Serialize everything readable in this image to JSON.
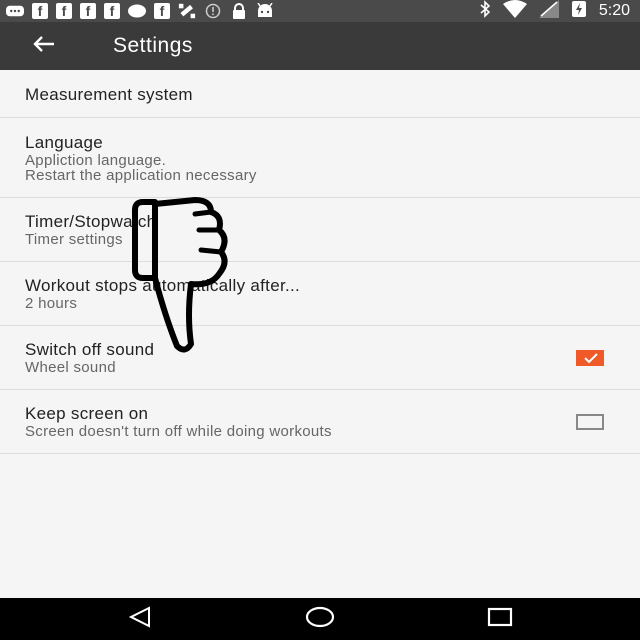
{
  "status_bar": {
    "time": "5:20",
    "fb_letter": "f",
    "icons": [
      "chat-icon",
      "facebook-icon",
      "facebook-icon",
      "facebook-icon",
      "facebook-icon",
      "circle-icon",
      "facebook-icon",
      "satellite-icon",
      "circle-icon",
      "lock-icon",
      "android-icon",
      "bluetooth-icon",
      "wifi-icon",
      "signal-icon",
      "battery-icon"
    ]
  },
  "toolbar": {
    "title": "Settings"
  },
  "settings": [
    {
      "title": "Measurement system"
    },
    {
      "title": "Language",
      "subtitle_line1": "Appliction language.",
      "subtitle_line2": "Restart the application necessary"
    },
    {
      "title": "Timer/Stopwatch",
      "subtitle": "Timer settings"
    },
    {
      "title": "Workout stops automatically after...",
      "subtitle": "2 hours"
    },
    {
      "title": "Switch off sound",
      "subtitle": "Wheel sound",
      "checked": true
    },
    {
      "title": "Keep screen on",
      "subtitle": "Screen doesn't turn off while doing workouts",
      "checked": false
    }
  ],
  "colors": {
    "accent": "#f05a28",
    "toolbar": "#3a3a3a",
    "status_bar": "#4a4a4a"
  }
}
